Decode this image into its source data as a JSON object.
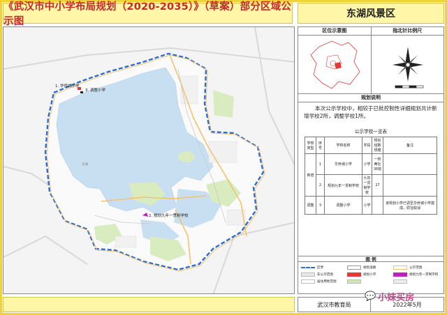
{
  "header": {
    "title": "《武汉市中小学布局规划（2020-2035）》（草案）部分区域公示图",
    "region": "东湖风景区"
  },
  "map": {
    "schools": [
      {
        "num": "1.",
        "name": "华侨城小学",
        "color": "#e53935"
      },
      {
        "num": "3.",
        "name": "调整小学",
        "color": "#222222"
      },
      {
        "num": "2.",
        "name": "规划九年一贯制学校",
        "color": "#9c27b0"
      }
    ],
    "place_label": "东湖"
  },
  "right_panel": {
    "overview_title": "区位示意图",
    "scale_title": "指北针比例尺",
    "plan_title": "规划说明",
    "plan_text": "本次公示学校中，相较于已批控制性详细规划共计新增学校2所，调整学校1所。",
    "table_title": "公示学校一览表",
    "table_headers": [
      "学校类型",
      "序号",
      "学校名称",
      "学段",
      "规划班数规模",
      "备注"
    ],
    "table_rows": [
      {
        "type": "新增",
        "no": "1",
        "name": "华侨城小学",
        "stage": "小学",
        "scale": "一校两址36班",
        "note": ""
      },
      {
        "type": "",
        "no": "2",
        "name": "规划九年一贯制学校",
        "stage": "九年一贯制学校",
        "scale": "27",
        "note": ""
      },
      {
        "type": "调整",
        "no": "3",
        "name": "调整小学",
        "stage": "小学",
        "scale": "",
        "note": "该规划小学已调至华侨城小学建成，原址取消"
      }
    ],
    "legend_title": "图  例",
    "legend": [
      {
        "label": "区界",
        "color": "#2b6cd4",
        "style": "dash"
      },
      {
        "label": "规划道路",
        "color": "#ffffff",
        "style": "box"
      },
      {
        "label": "公示范围",
        "color": "#f5c26b",
        "style": "outline"
      },
      {
        "label": "非公示范围",
        "color": "#e8e8e8",
        "style": "box"
      },
      {
        "label": "规划小学",
        "color": "#e53935",
        "style": "box"
      },
      {
        "label": "规划九年一贯制学校",
        "color": "#c020c0",
        "style": "box"
      },
      {
        "label": "居住用地范围",
        "color": "#ffffff",
        "style": "box"
      },
      {
        "label": "",
        "color": "#cfe8b0",
        "style": "box"
      },
      {
        "label": "",
        "color": "#eeeeee",
        "style": "box"
      }
    ]
  },
  "footer": {
    "org": "武汉市教育局",
    "date": "2022年5月",
    "watermark": "小妹买房"
  }
}
